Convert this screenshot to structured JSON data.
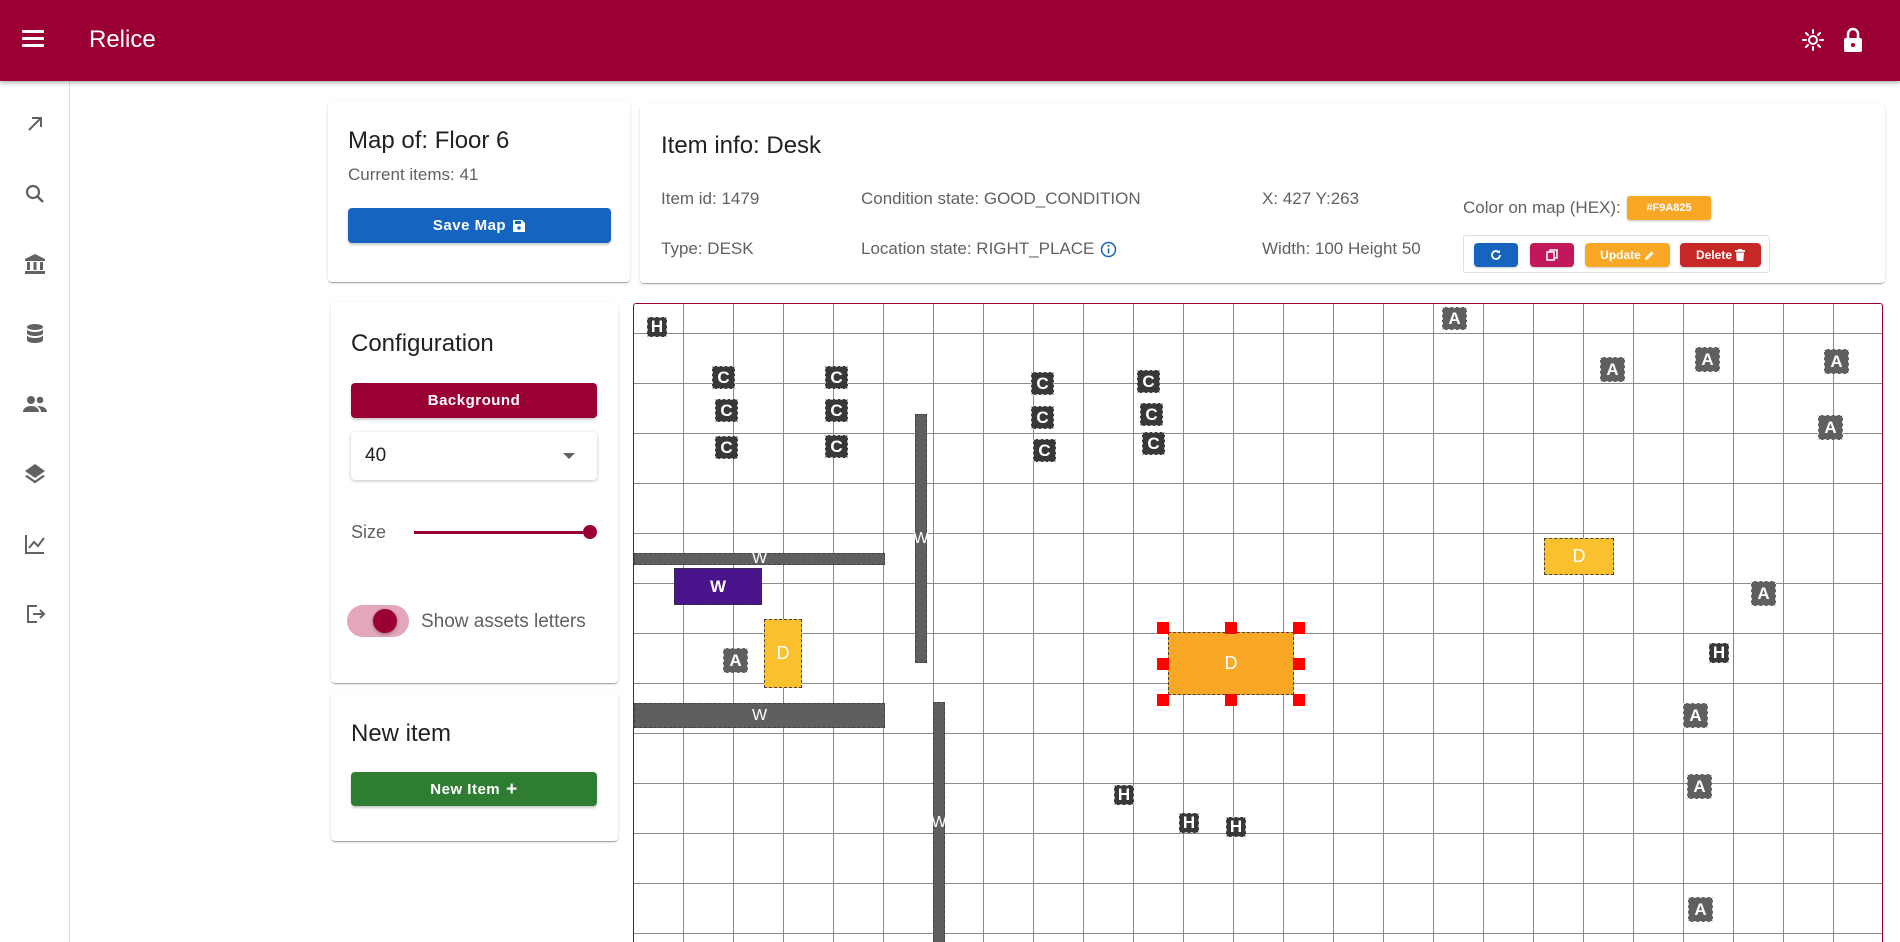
{
  "app": {
    "title": "Relice"
  },
  "colors": {
    "primary": "#9a0036",
    "blue": "#1565c0",
    "pink": "#c2185b",
    "orange": "#f9a825",
    "red": "#c62828",
    "green": "#2e7d32",
    "purple": "#4a148c",
    "yellow": "#fbc02d"
  },
  "topbar": {
    "icons": [
      "brightness-icon",
      "lock-icon"
    ]
  },
  "sidebar": {
    "items": [
      {
        "name": "north-east-arrow-icon"
      },
      {
        "name": "search-icon"
      },
      {
        "name": "bank-icon"
      },
      {
        "name": "database-icon"
      },
      {
        "name": "people-icon"
      },
      {
        "name": "layers-icon"
      },
      {
        "name": "chart-icon"
      },
      {
        "name": "logout-icon"
      }
    ]
  },
  "map_card": {
    "title": "Map of: Floor 6",
    "current_items": "Current items: 41",
    "save_label": "Save Map"
  },
  "config": {
    "title": "Configuration",
    "background_label": "Background",
    "select_value": "40",
    "size_label": "Size",
    "slider_value": 1.0,
    "toggle_label": "Show assets letters",
    "toggle_on": true
  },
  "new_item": {
    "title": "New item",
    "button_label": "New Item"
  },
  "item_info": {
    "title": "Item info: Desk",
    "item_id": "Item id: 1479",
    "type": "Type: DESK",
    "condition": "Condition state: GOOD_CONDITION",
    "location": "Location state: RIGHT_PLACE",
    "xy": "X: 427 Y:263",
    "size": "Width: 100 Height 50",
    "color_label": "Color on map (HEX):",
    "color_hex": "#F9A825",
    "update_label": "Update",
    "delete_label": "Delete"
  },
  "map": {
    "items": [
      {
        "letter": "H",
        "kind": "h"
      },
      {
        "letter": "C",
        "kind": "c"
      },
      {
        "letter": "C",
        "kind": "c"
      },
      {
        "letter": "C",
        "kind": "c"
      },
      {
        "letter": "C",
        "kind": "c"
      },
      {
        "letter": "C",
        "kind": "c"
      },
      {
        "letter": "C",
        "kind": "c"
      },
      {
        "letter": "C",
        "kind": "c"
      },
      {
        "letter": "C",
        "kind": "c"
      },
      {
        "letter": "C",
        "kind": "c"
      },
      {
        "letter": "C",
        "kind": "c"
      },
      {
        "letter": "C",
        "kind": "c"
      },
      {
        "letter": "C",
        "kind": "c"
      },
      {
        "letter": "W",
        "kind": "w"
      },
      {
        "letter": "W",
        "kind": "w"
      },
      {
        "letter": "W",
        "kind": "w"
      },
      {
        "letter": "W",
        "kind": "w"
      },
      {
        "letter": "W",
        "kind": "wp"
      },
      {
        "letter": "D",
        "kind": "d"
      },
      {
        "letter": "D",
        "kind": "d"
      },
      {
        "letter": "D",
        "kind": "d-sel"
      },
      {
        "letter": "A",
        "kind": "a"
      },
      {
        "letter": "A",
        "kind": "a"
      },
      {
        "letter": "A",
        "kind": "a"
      },
      {
        "letter": "A",
        "kind": "a"
      },
      {
        "letter": "A",
        "kind": "a"
      },
      {
        "letter": "A",
        "kind": "a"
      },
      {
        "letter": "A",
        "kind": "a"
      },
      {
        "letter": "A",
        "kind": "a"
      },
      {
        "letter": "A",
        "kind": "a"
      },
      {
        "letter": "A",
        "kind": "a"
      },
      {
        "letter": "H",
        "kind": "h"
      },
      {
        "letter": "H",
        "kind": "h"
      },
      {
        "letter": "H",
        "kind": "h"
      },
      {
        "letter": "H",
        "kind": "h"
      }
    ]
  }
}
